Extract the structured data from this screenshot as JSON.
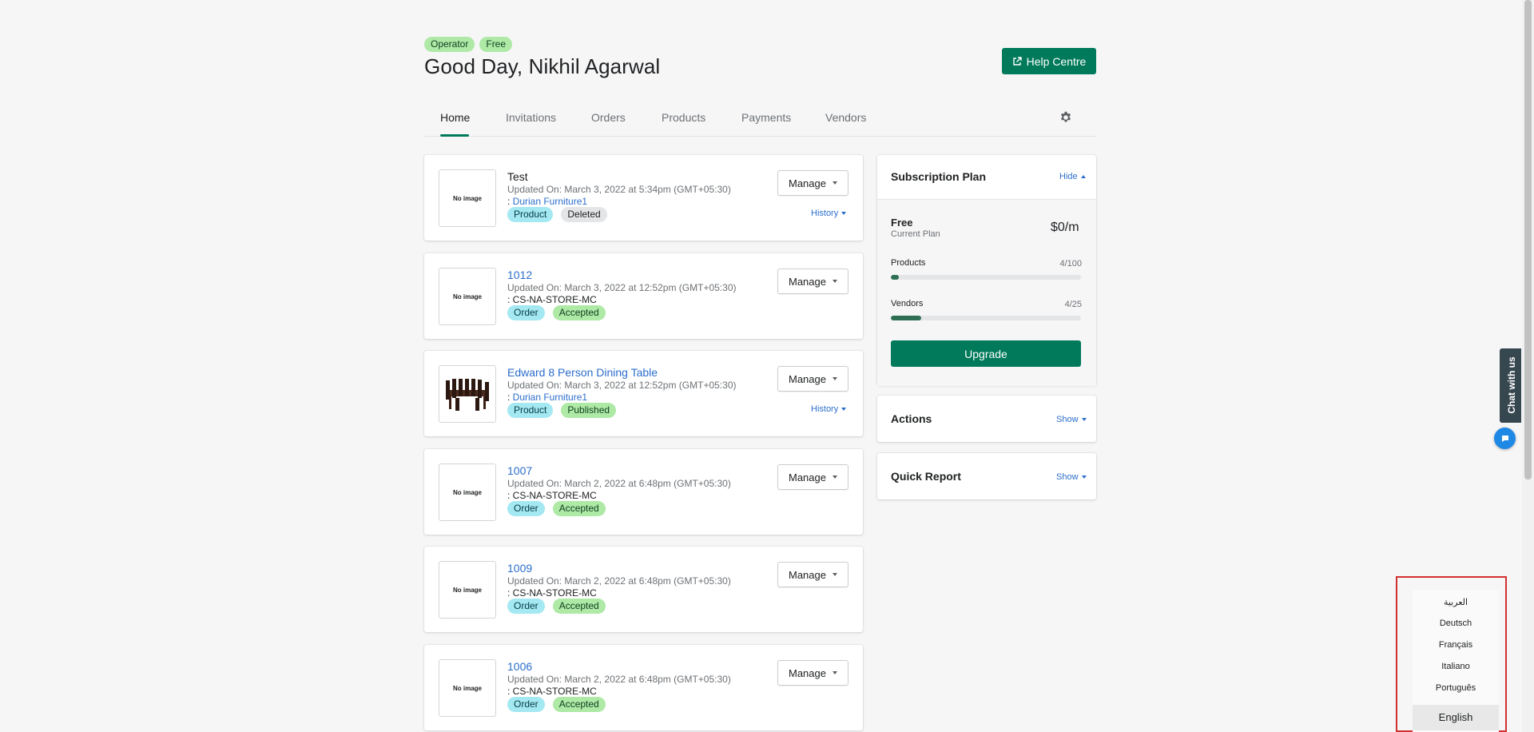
{
  "header": {
    "badges": [
      "Operator",
      "Free"
    ],
    "greeting": "Good Day, Nikhil Agarwal",
    "help_label": "Help Centre"
  },
  "tabs": [
    "Home",
    "Invitations",
    "Orders",
    "Products",
    "Payments",
    "Vendors"
  ],
  "activity": [
    {
      "title": "Test",
      "title_is_link": false,
      "updated": "Updated On: March 3, 2022 at 5:34pm (GMT+05:30)",
      "source_prefix": ": ",
      "source": "Durian Furniture1",
      "source_is_link": true,
      "tags": [
        "Product",
        "Deleted"
      ],
      "image": "No image",
      "manage": "Manage",
      "history": "History"
    },
    {
      "title": "1012",
      "title_is_link": true,
      "updated": "Updated On: March 3, 2022 at 12:52pm (GMT+05:30)",
      "source_prefix": ": ",
      "source": "CS-NA-STORE-MC",
      "source_is_link": false,
      "tags": [
        "Order",
        "Accepted"
      ],
      "image": "No image",
      "manage": "Manage",
      "history": ""
    },
    {
      "title": "Edward 8 Person Dining Table",
      "title_is_link": true,
      "updated": "Updated On: March 3, 2022 at 12:52pm (GMT+05:30)",
      "source_prefix": ": ",
      "source": "Durian Furniture1",
      "source_is_link": true,
      "tags": [
        "Product",
        "Published"
      ],
      "image": "",
      "manage": "Manage",
      "history": "History"
    },
    {
      "title": "1007",
      "title_is_link": true,
      "updated": "Updated On: March 2, 2022 at 6:48pm (GMT+05:30)",
      "source_prefix": ": ",
      "source": "CS-NA-STORE-MC",
      "source_is_link": false,
      "tags": [
        "Order",
        "Accepted"
      ],
      "image": "No image",
      "manage": "Manage",
      "history": ""
    },
    {
      "title": "1009",
      "title_is_link": true,
      "updated": "Updated On: March 2, 2022 at 6:48pm (GMT+05:30)",
      "source_prefix": ": ",
      "source": "CS-NA-STORE-MC",
      "source_is_link": false,
      "tags": [
        "Order",
        "Accepted"
      ],
      "image": "No image",
      "manage": "Manage",
      "history": ""
    },
    {
      "title": "1006",
      "title_is_link": true,
      "updated": "Updated On: March 2, 2022 at 6:48pm (GMT+05:30)",
      "source_prefix": ": ",
      "source": "CS-NA-STORE-MC",
      "source_is_link": false,
      "tags": [
        "Order",
        "Accepted"
      ],
      "image": "No image",
      "manage": "Manage",
      "history": ""
    }
  ],
  "subscription": {
    "title": "Subscription Plan",
    "toggle": "Hide",
    "plan_name": "Free",
    "plan_sub": "Current Plan",
    "price": "$0/m",
    "meters": [
      {
        "label": "Products",
        "value": "4/100",
        "fraction": 0.04
      },
      {
        "label": "Vendors",
        "value": "4/25",
        "fraction": 0.16
      }
    ],
    "upgrade": "Upgrade"
  },
  "actions": {
    "title": "Actions",
    "toggle": "Show"
  },
  "quick_report": {
    "title": "Quick Report",
    "toggle": "Show"
  },
  "chat": {
    "label": "Chat with us"
  },
  "languages": {
    "items": [
      "العربية",
      "Deutsch",
      "Français",
      "Italiano",
      "Português"
    ],
    "selected": "English"
  },
  "colors": {
    "accent": "#007a5a",
    "link": "#2c6ecb",
    "highlight_border": "#d32f2f"
  }
}
